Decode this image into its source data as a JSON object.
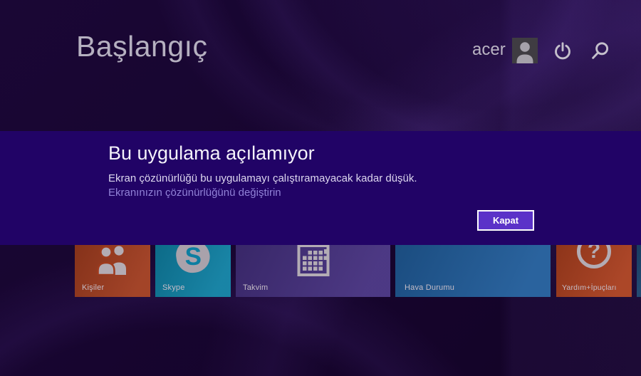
{
  "header": {
    "title": "Başlangıç",
    "user_name": "acer"
  },
  "dialog": {
    "title": "Bu uygulama açılamıyor",
    "message": "Ekran çözünürlüğü bu uygulamayı çalıştıramayacak kadar düşük.",
    "link_text": "Ekranınızın çözünürlüğünü değiştirin",
    "close_button": "Kapat"
  },
  "tiles": [
    {
      "label": "Kişiler",
      "icon": "people-icon",
      "color": "#9e3a1d",
      "size": "medium"
    },
    {
      "label": "Skype",
      "icon": "skype-icon",
      "color": "#0d7ea1",
      "size": "medium"
    },
    {
      "label": "Takvim",
      "icon": "calendar-icon",
      "color": "#432e7d",
      "size": "wide"
    },
    {
      "label": "Hava Durumu",
      "icon": "none",
      "color": "#1f5b99",
      "size": "wide"
    },
    {
      "label": "Yardım+İpuçları",
      "icon": "help-icon",
      "color": "#a83d1d",
      "size": "medium"
    },
    {
      "label": "",
      "icon": "none",
      "color": "#17406a",
      "size": "partial"
    }
  ],
  "colors": {
    "background": "#17052f",
    "dialog_band": "#210366",
    "close_button_fill": "#5b32c8",
    "link": "#9182d7",
    "header_text": "#b5b0c0",
    "tile_icon": "#b3acb4"
  }
}
